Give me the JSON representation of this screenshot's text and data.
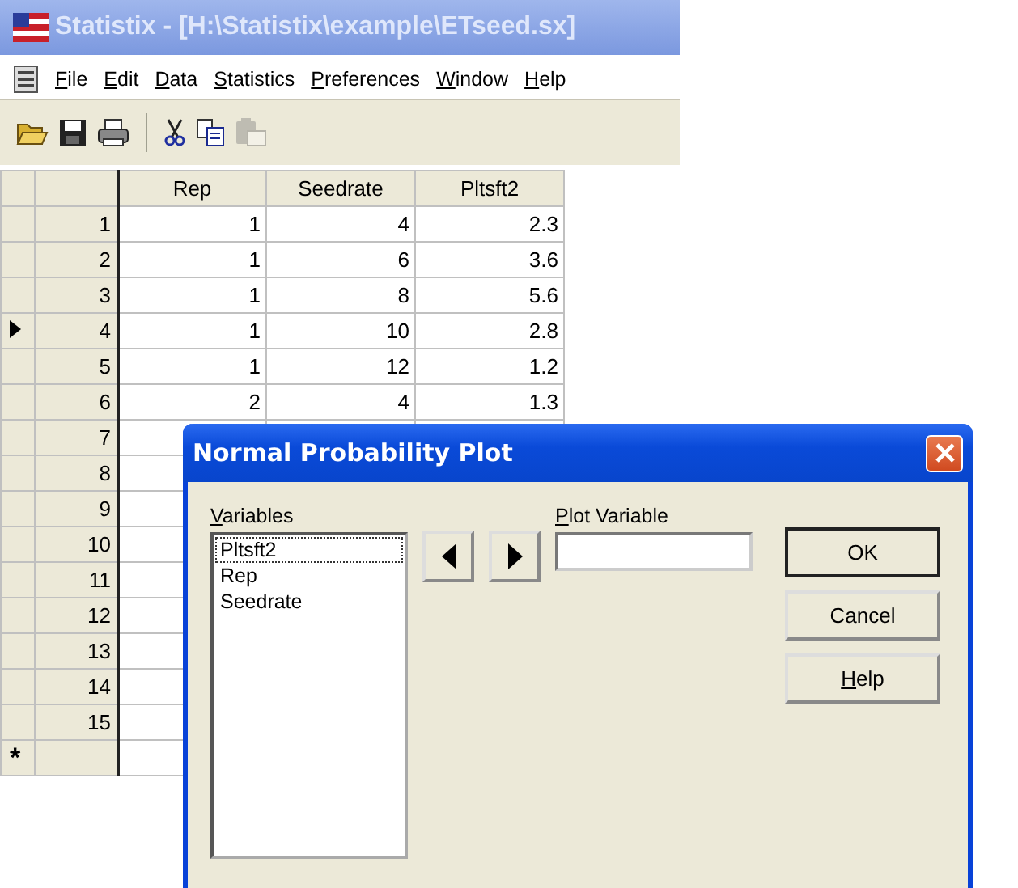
{
  "window": {
    "title": "Statistix - [H:\\Statistix\\example\\ETseed.sx]"
  },
  "menu": [
    {
      "label": "File"
    },
    {
      "label": "Edit"
    },
    {
      "label": "Data"
    },
    {
      "label": "Statistics"
    },
    {
      "label": "Preferences"
    },
    {
      "label": "Window"
    },
    {
      "label": "Help"
    }
  ],
  "toolbar": [
    {
      "kind": "open",
      "disabled": false
    },
    {
      "kind": "save",
      "disabled": false
    },
    {
      "kind": "print",
      "disabled": false
    },
    {
      "kind": "separator"
    },
    {
      "kind": "cut",
      "disabled": false
    },
    {
      "kind": "copy",
      "disabled": false
    },
    {
      "kind": "paste",
      "disabled": true
    }
  ],
  "grid": {
    "columns": [
      "Rep",
      "Seedrate",
      "Pltsft2"
    ],
    "rows": [
      {
        "number": "1",
        "cells": [
          "1",
          "4",
          "2.3"
        ],
        "selected": false
      },
      {
        "number": "2",
        "cells": [
          "1",
          "6",
          "3.6"
        ],
        "selected": false
      },
      {
        "number": "3",
        "cells": [
          "1",
          "8",
          "5.6"
        ],
        "selected": false
      },
      {
        "number": "4",
        "cells": [
          "1",
          "10",
          "2.8"
        ],
        "selected": true
      },
      {
        "number": "5",
        "cells": [
          "1",
          "12",
          "1.2"
        ],
        "selected": false
      },
      {
        "number": "6",
        "cells": [
          "2",
          "4",
          "1.3"
        ],
        "selected": false
      },
      {
        "number": "7",
        "selected": false
      },
      {
        "number": "8",
        "selected": false
      },
      {
        "number": "9",
        "selected": false
      },
      {
        "number": "10",
        "selected": false
      },
      {
        "number": "11",
        "selected": false
      },
      {
        "number": "12",
        "selected": false
      },
      {
        "number": "13",
        "selected": false
      },
      {
        "number": "14",
        "selected": false
      },
      {
        "number": "15",
        "selected": false
      }
    ],
    "new_row_marker": "*"
  },
  "dialog": {
    "title": "Normal Probability Plot",
    "variables_label": "Variables",
    "variables": [
      {
        "label": "Pltsft2",
        "focused": true
      },
      {
        "label": "Rep",
        "focused": false
      },
      {
        "label": "Seedrate",
        "focused": false
      }
    ],
    "plot_variable_label": "Plot Variable",
    "buttons": [
      {
        "label": "OK",
        "default": true
      },
      {
        "label": "Cancel",
        "default": false
      },
      {
        "label": "Help",
        "default": false
      }
    ]
  }
}
